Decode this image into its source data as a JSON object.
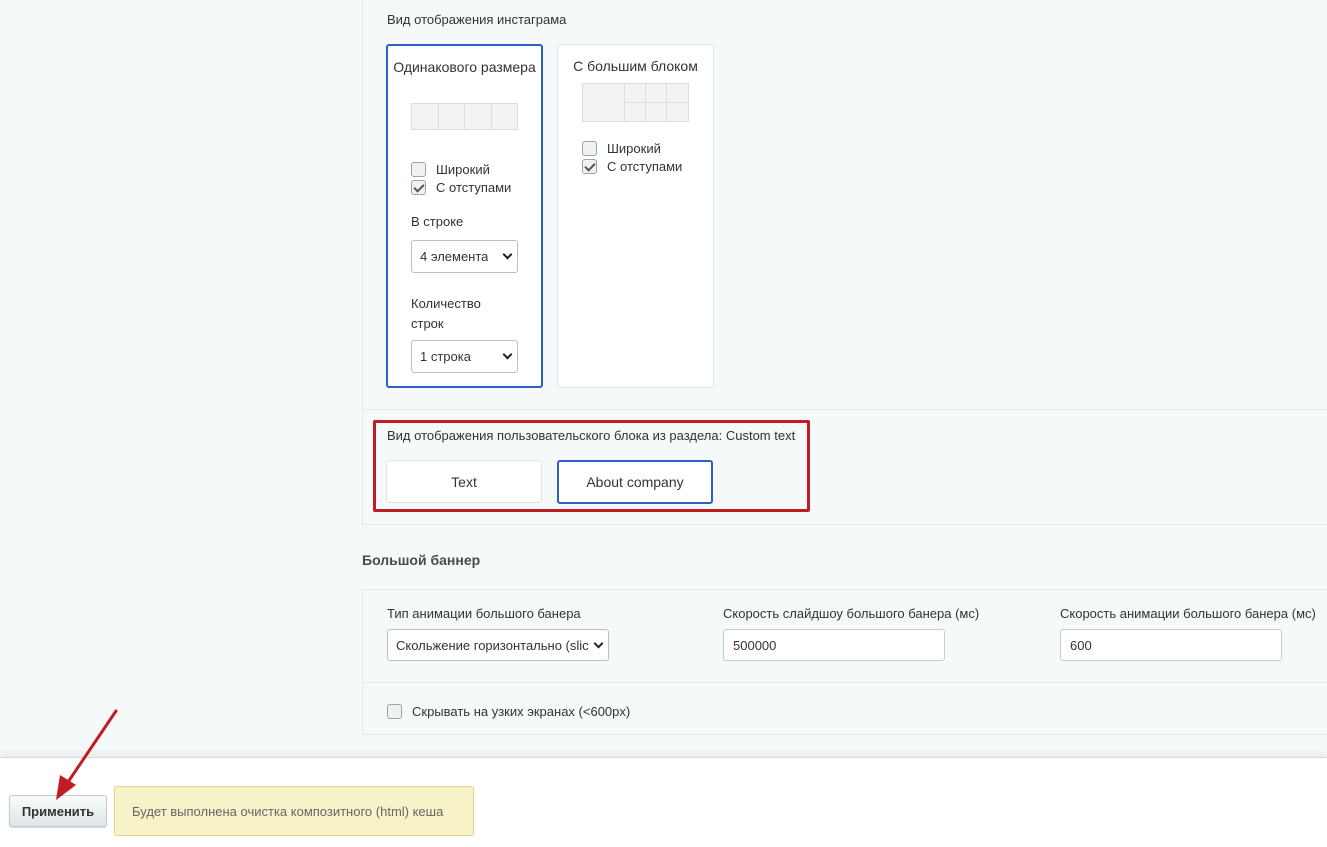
{
  "instagram": {
    "label": "Вид отображения инстаграма",
    "options": [
      {
        "title": "Одинакового размера",
        "selected": true,
        "checkboxes": [
          {
            "label": "Широкий",
            "checked": false
          },
          {
            "label": "С отступами",
            "checked": true
          }
        ],
        "per_row_label": "В строке",
        "per_row_value": "4 элемента",
        "rows_label": "Количество строк",
        "rows_value": "1 строка"
      },
      {
        "title": "С большим блоком",
        "selected": false,
        "checkboxes": [
          {
            "label": "Широкий",
            "checked": false
          },
          {
            "label": "С отступами",
            "checked": true
          }
        ]
      }
    ]
  },
  "custom_block": {
    "label": "Вид отображения пользовательского блока из раздела: Custom text",
    "options": [
      {
        "label": "Text",
        "selected": false
      },
      {
        "label": "About company",
        "selected": true
      }
    ],
    "highlight_color": "#c01c24"
  },
  "big_banner": {
    "title": "Большой баннер",
    "animation_type_label": "Тип анимации большого банера",
    "animation_type_value": "Скольжение горизонтально (slic",
    "slideshow_speed_label": "Скорость слайдшоу большого банера (мс)",
    "slideshow_speed_value": "500000",
    "animation_speed_label": "Скорость анимации большого банера (мс)",
    "animation_speed_value": "600",
    "hide_narrow_label": "Скрывать на узких экранах (<600px)",
    "hide_narrow_checked": false
  },
  "footer": {
    "apply_label": "Применить",
    "notice": "Будет выполнена очистка композитного (html) кеша"
  },
  "colors": {
    "selected_border": "#2f5ec4",
    "annotation_arrow": "#c01c24",
    "notice_bg": "#f8f2c8"
  }
}
